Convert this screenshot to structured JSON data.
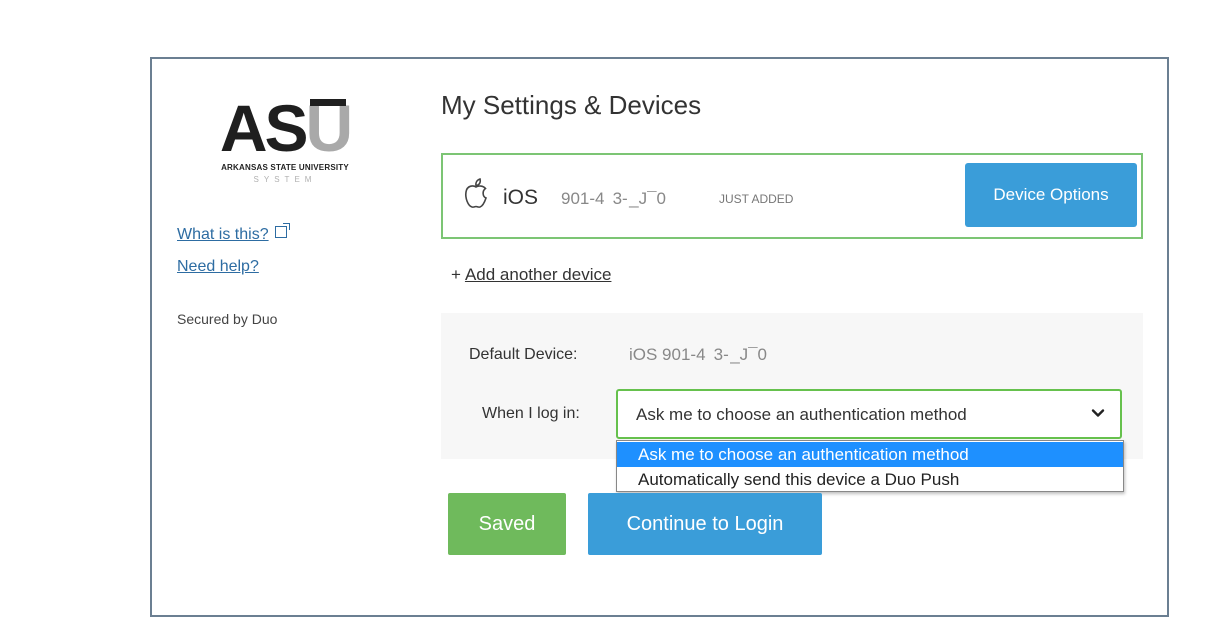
{
  "logo": {
    "letters_a": "AS",
    "letters_u": "U",
    "line1": "ARKANSAS STATE UNIVERSITY",
    "line2": "SYSTEM"
  },
  "sidebar": {
    "what_is_this": "What is this?",
    "need_help": "Need help?",
    "secured_by": "Secured by Duo"
  },
  "main": {
    "title": "My Settings & Devices",
    "device": {
      "icon": "apple-icon",
      "name": "iOS",
      "number": "901-4  3- _J¯0",
      "badge": "JUST ADDED",
      "options_label": "Device Options"
    },
    "add_device": {
      "prefix": "+",
      "label": "Add another device"
    },
    "settings": {
      "default_device_label": "Default Device:",
      "default_device_value": "iOS 901-4  3- _J¯0",
      "login_label": "When I log in:",
      "login_selected": "Ask me to choose an authentication method",
      "login_options": [
        "Ask me to choose an authentication method",
        "Automatically send this device a Duo Push"
      ]
    },
    "buttons": {
      "saved": "Saved",
      "continue": "Continue to Login"
    }
  },
  "colors": {
    "accent_blue": "#3a9dd9",
    "success_green": "#6fba5c",
    "card_border_green": "#7cc574",
    "link_blue": "#2d6ca2"
  }
}
